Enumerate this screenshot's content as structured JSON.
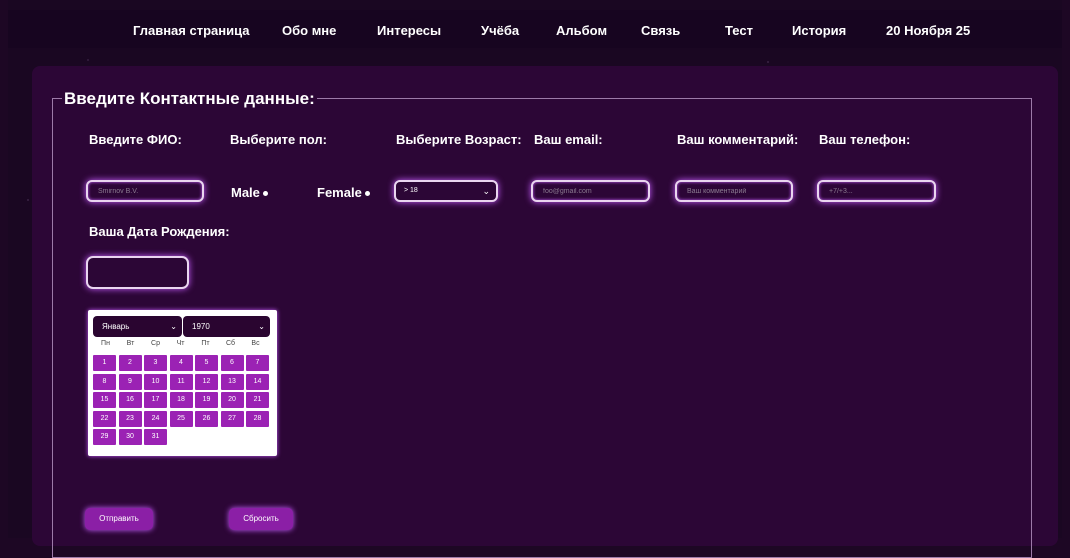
{
  "nav": {
    "items": [
      "Главная страница",
      "Обо мне",
      "Интересы",
      "Учёба",
      "Альбом",
      "Связь",
      "Тест",
      "История"
    ],
    "date": "20 Ноября 25"
  },
  "form": {
    "legend": "Введите Контактные данные:",
    "labels": {
      "fio": "Введите ФИО:",
      "gender": "Выберите пол:",
      "age": "Выберите Возраст:",
      "email": "Ваш email:",
      "comment": "Ваш комментарий:",
      "phone": "Ваш телефон:",
      "birthdate": "Ваша Дата Рождения:"
    },
    "fio_placeholder": "Smirnov B.V.",
    "gender_male": "Male",
    "gender_female": "Female",
    "age_selected": "> 18",
    "email_placeholder": "foo@gmail.com",
    "comment_placeholder": "Ваш комментарий",
    "phone_placeholder": "+7/+3...",
    "birthdate_value": ""
  },
  "calendar": {
    "month": "Январь",
    "year": "1970",
    "weekdays": [
      "Пн",
      "Вт",
      "Ср",
      "Чт",
      "Пт",
      "Сб",
      "Вс"
    ],
    "days": [
      "1",
      "2",
      "3",
      "4",
      "5",
      "6",
      "7",
      "8",
      "9",
      "10",
      "11",
      "12",
      "13",
      "14",
      "15",
      "16",
      "17",
      "18",
      "19",
      "20",
      "21",
      "22",
      "23",
      "24",
      "25",
      "26",
      "27",
      "28",
      "29",
      "30",
      "31"
    ]
  },
  "buttons": {
    "submit": "Отправить",
    "reset": "Сбросить"
  },
  "colors": {
    "panel": "#2c0636",
    "accent": "#9b22b4",
    "glow": "#c65cff"
  }
}
